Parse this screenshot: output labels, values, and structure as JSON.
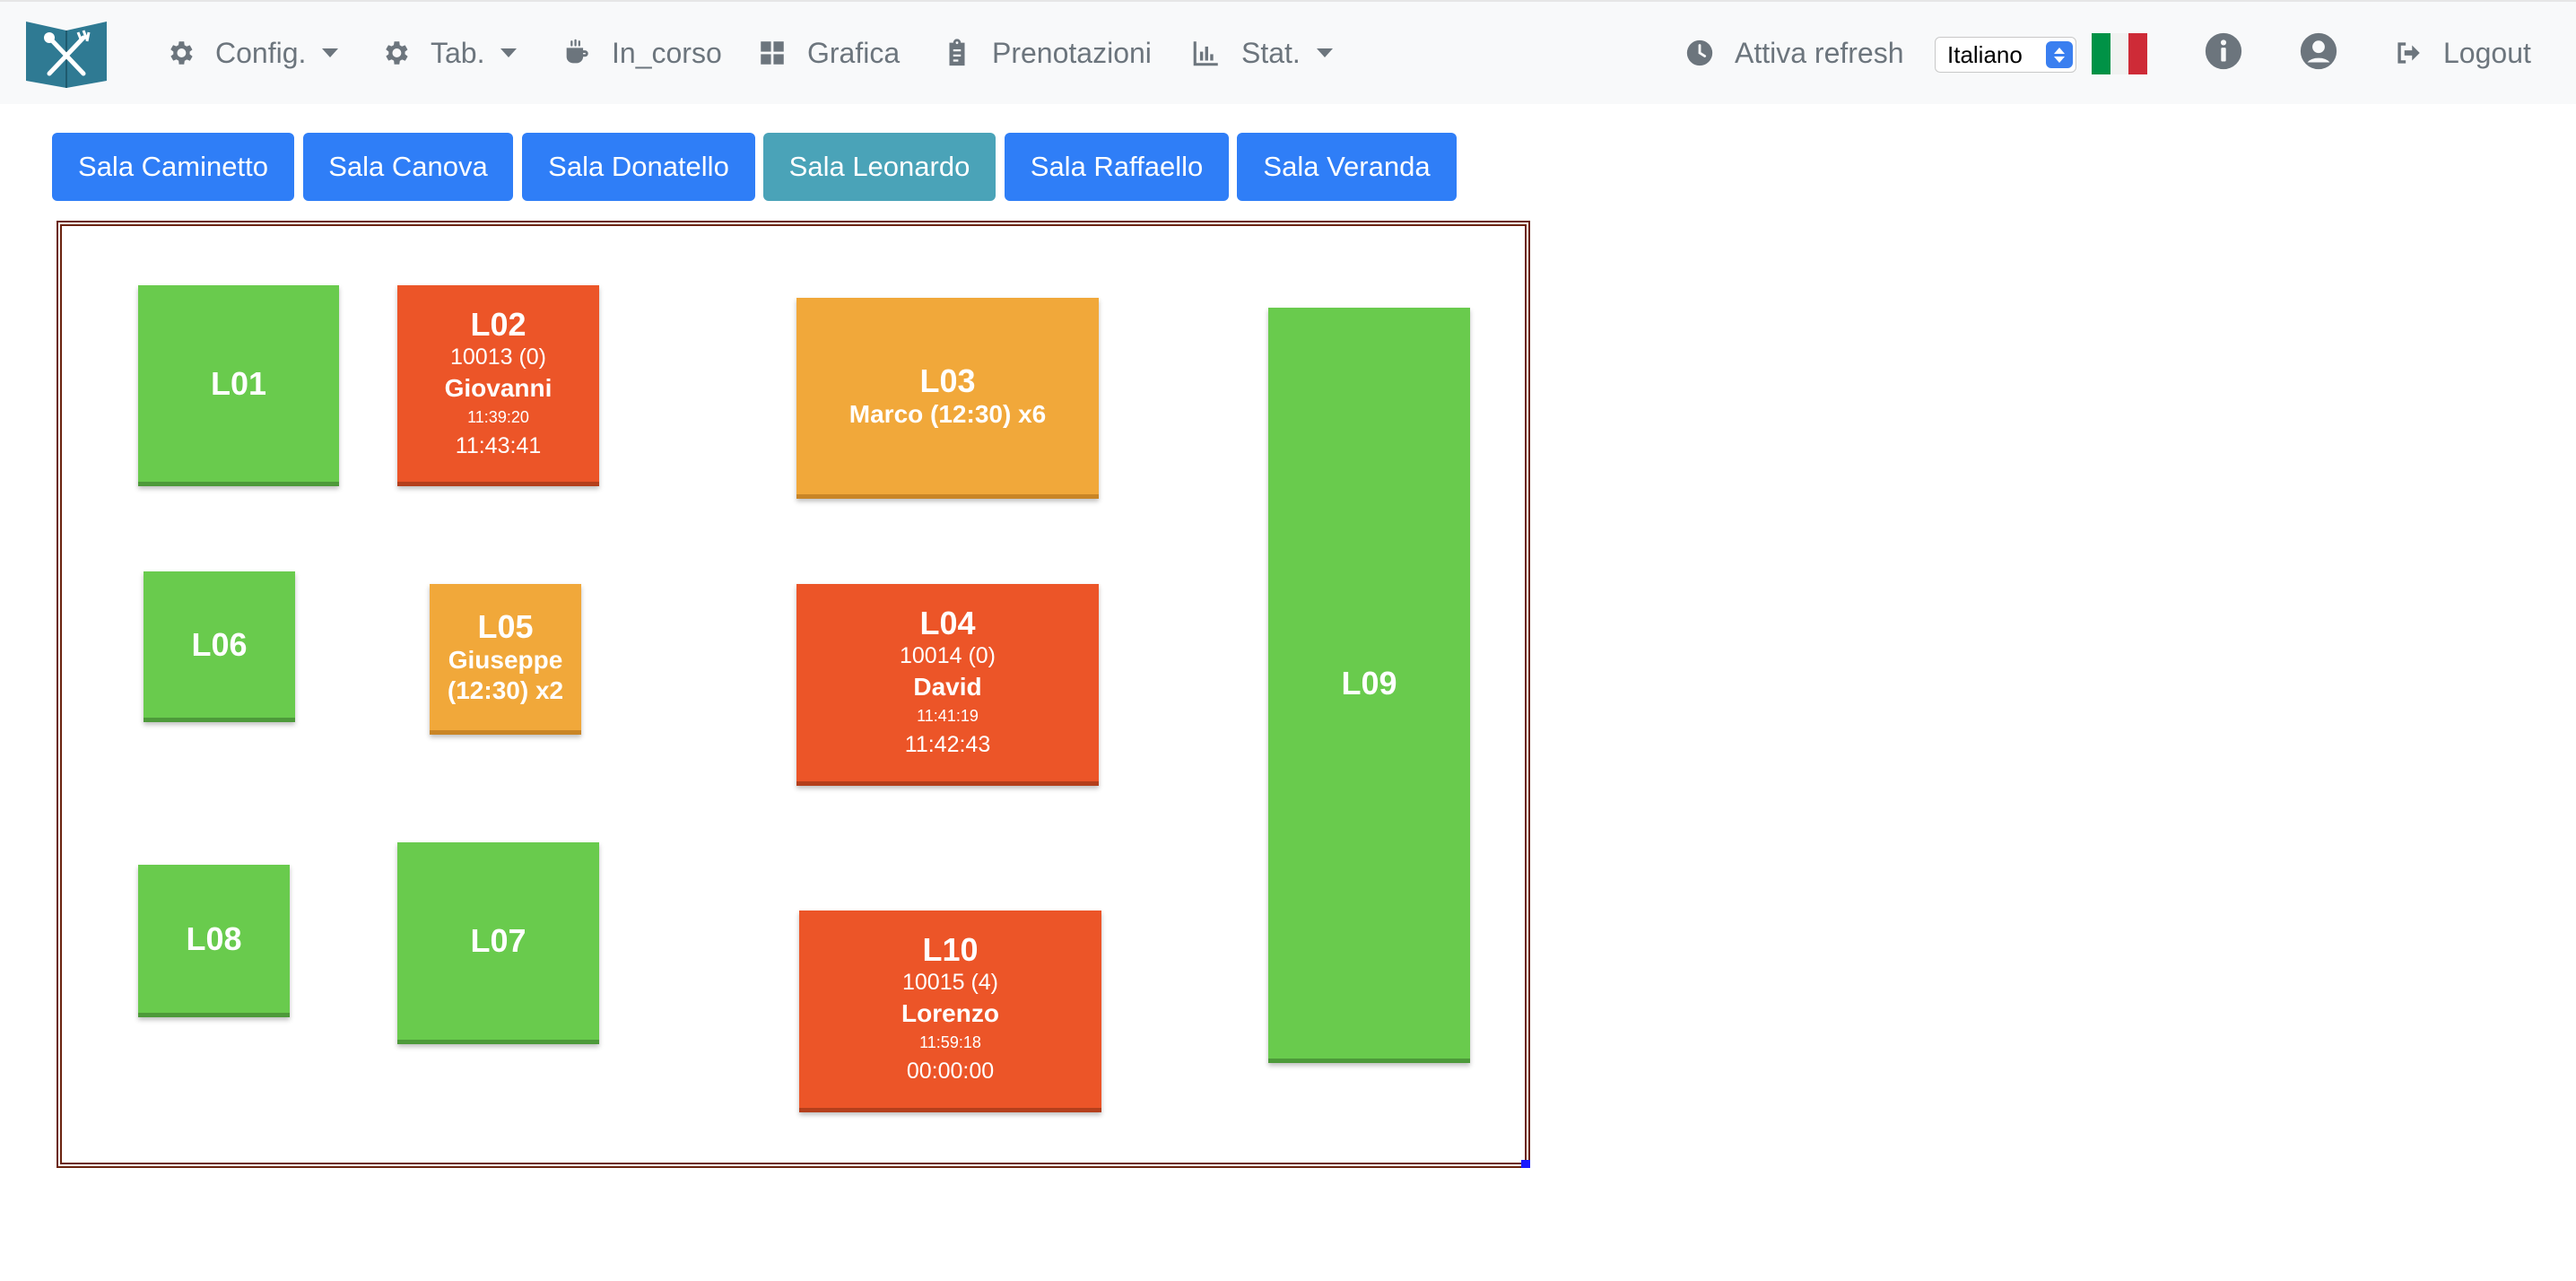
{
  "navbar": {
    "logo_icon": "restaurant-book-icon",
    "items": [
      {
        "label": "Config.",
        "icon": "gear-icon",
        "dropdown": true
      },
      {
        "label": "Tab.",
        "icon": "gear-icon",
        "dropdown": true
      },
      {
        "label": "In_corso",
        "icon": "coffee-cup-icon",
        "dropdown": false
      },
      {
        "label": "Grafica",
        "icon": "grid-icon",
        "dropdown": false
      },
      {
        "label": "Prenotazioni",
        "icon": "clipboard-icon",
        "dropdown": false
      },
      {
        "label": "Stat.",
        "icon": "bar-chart-icon",
        "dropdown": true
      }
    ],
    "refresh": {
      "label": "Attiva refresh",
      "icon": "clock-icon"
    },
    "language": {
      "selected": "Italiano",
      "flag_colors": [
        "#009246",
        "#f1f2f1",
        "#ce2b37"
      ]
    },
    "info_icon": "info-icon",
    "user_icon": "user-circle-icon",
    "logout": {
      "label": "Logout",
      "icon": "sign-out-icon"
    }
  },
  "rooms": {
    "active": "Sala Leonardo",
    "items": [
      "Sala Caminetto",
      "Sala Canova",
      "Sala Donatello",
      "Sala Leonardo",
      "Sala Raffaello",
      "Sala Veranda"
    ]
  },
  "colors": {
    "free": "#69cb4d",
    "occupied": "#ec5528",
    "reserved": "#f1a83a",
    "room_button": "#2f7ef7",
    "room_button_active": "#4aa3b8",
    "floor_border": "#6b2410"
  },
  "tables": [
    {
      "code": "L01",
      "status": "free"
    },
    {
      "code": "L02",
      "status": "occupied",
      "order": "10013 (0)",
      "customer": "Giovanni",
      "opened": "11:39:20",
      "elapsed": "11:43:41"
    },
    {
      "code": "L03",
      "status": "reserved",
      "reservation": "Marco (12:30) x6"
    },
    {
      "code": "L04",
      "status": "occupied",
      "order": "10014 (0)",
      "customer": "David",
      "opened": "11:41:19",
      "elapsed": "11:42:43"
    },
    {
      "code": "L05",
      "status": "reserved",
      "reservation_line1": "Giuseppe",
      "reservation_line2": "(12:30) x2"
    },
    {
      "code": "L06",
      "status": "free"
    },
    {
      "code": "L07",
      "status": "free"
    },
    {
      "code": "L08",
      "status": "free"
    },
    {
      "code": "L09",
      "status": "free"
    },
    {
      "code": "L10",
      "status": "occupied",
      "order": "10015 (4)",
      "customer": "Lorenzo",
      "opened": "11:59:18",
      "elapsed": "00:00:00"
    }
  ]
}
